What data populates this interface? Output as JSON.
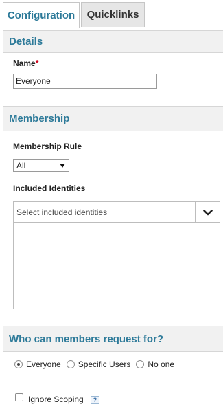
{
  "tabs": [
    {
      "label": "Configuration",
      "active": true
    },
    {
      "label": "Quicklinks",
      "active": false
    }
  ],
  "details": {
    "header": "Details",
    "name_label": "Name",
    "required_marker": "*",
    "name_value": "Everyone"
  },
  "membership": {
    "header": "Membership",
    "rule_label": "Membership Rule",
    "rule_value": "All",
    "identities_label": "Included Identities",
    "identities_placeholder": "Select included identities"
  },
  "request_for": {
    "header": "Who can members request for?",
    "options": [
      "Everyone",
      "Specific Users",
      "No one"
    ],
    "selected": "Everyone"
  },
  "ignore_scoping": {
    "label": "Ignore Scoping",
    "checked": false,
    "help_text": "?"
  }
}
